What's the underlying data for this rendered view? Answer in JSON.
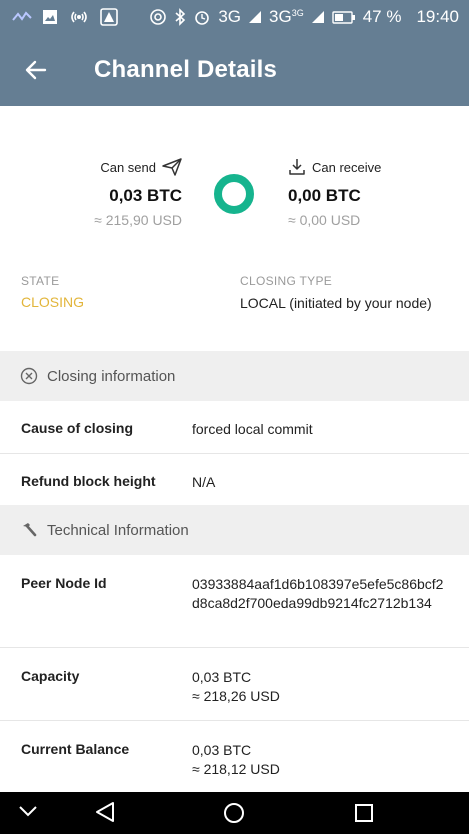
{
  "status_bar": {
    "network_3g_a": "3G",
    "network_3g_b": "3G",
    "network_3g_badge": "3G",
    "battery": "47 %",
    "time": "19:40"
  },
  "app_bar": {
    "title": "Channel Details"
  },
  "summary": {
    "send": {
      "label": "Can send",
      "amount": "0,03 BTC",
      "fiat": "≈ 215,90 USD"
    },
    "receive": {
      "label": "Can receive",
      "amount": "0,00 BTC",
      "fiat": "≈ 0,00 USD"
    },
    "donut_color": "#16b48e"
  },
  "state": {
    "label": "STATE",
    "value": "CLOSING",
    "value_color": "#e2b53a"
  },
  "closing_type": {
    "label": "CLOSING TYPE",
    "value": "LOCAL (initiated by your node)"
  },
  "closing_info": {
    "header": "Closing information",
    "rows": [
      {
        "key": "Cause of closing",
        "value": "forced local commit"
      },
      {
        "key": "Refund block height",
        "value": "N/A"
      }
    ]
  },
  "technical": {
    "header": "Technical Information",
    "peer_node_id": {
      "key": "Peer Node Id",
      "value": "03933884aaf1d6b108397e5efe5c86bcf2d8ca8d2f700eda99db9214fc2712b134"
    },
    "capacity": {
      "key": "Capacity",
      "btc": "0,03 BTC",
      "fiat": "≈ 218,26 USD"
    },
    "current_balance": {
      "key": "Current Balance",
      "btc": "0,03 BTC",
      "fiat": "≈ 218,12 USD"
    }
  },
  "colors": {
    "header_bg": "#657e93",
    "section_bg": "#efefef",
    "accent_green": "#16b48e"
  }
}
